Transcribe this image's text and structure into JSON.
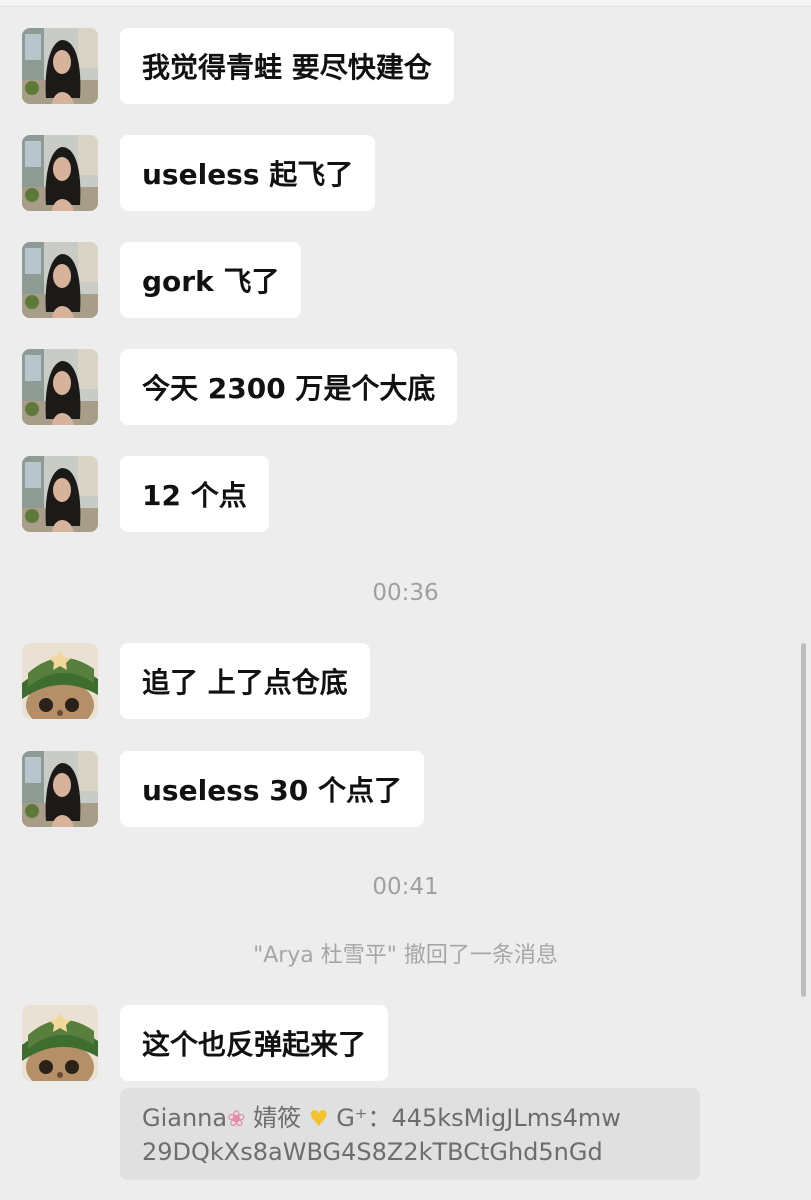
{
  "messages": [
    {
      "avatar": "woman-avatar",
      "text": "我觉得青蛙 要尽快建仓"
    },
    {
      "avatar": "woman-avatar",
      "text": "useless 起飞了"
    },
    {
      "avatar": "woman-avatar",
      "text": "gork 飞了"
    },
    {
      "avatar": "woman-avatar",
      "text": "今天 2300 万是个大底"
    },
    {
      "avatar": "woman-avatar",
      "text": "12 个点"
    },
    {
      "avatar": "cat-avatar",
      "text": "追了 上了点仓底"
    },
    {
      "avatar": "woman-avatar",
      "text": "useless 30 个点了"
    },
    {
      "avatar": "cat-avatar",
      "text": "这个也反弹起来了"
    }
  ],
  "timestamps": [
    "00:36",
    "00:41"
  ],
  "system_notice": "\"Arya 杜雪平\" 撤回了一条消息",
  "quote": {
    "name": "Gianna",
    "name_cont": "婧筱",
    "prefix": "G⁺：",
    "line1_rest": "445ksMigJLms4mw",
    "line2": "29DQkXs8aWBG4S8Z2kTBCtGhd5nGd",
    "flower_icon": "cherry-blossom-icon",
    "heart_icon": "yellow-heart-icon"
  },
  "colors": {
    "background": "#ededed",
    "bubble": "#ffffff",
    "quote_bg": "#e0e0e0",
    "timestamp": "#a0a0a0"
  }
}
